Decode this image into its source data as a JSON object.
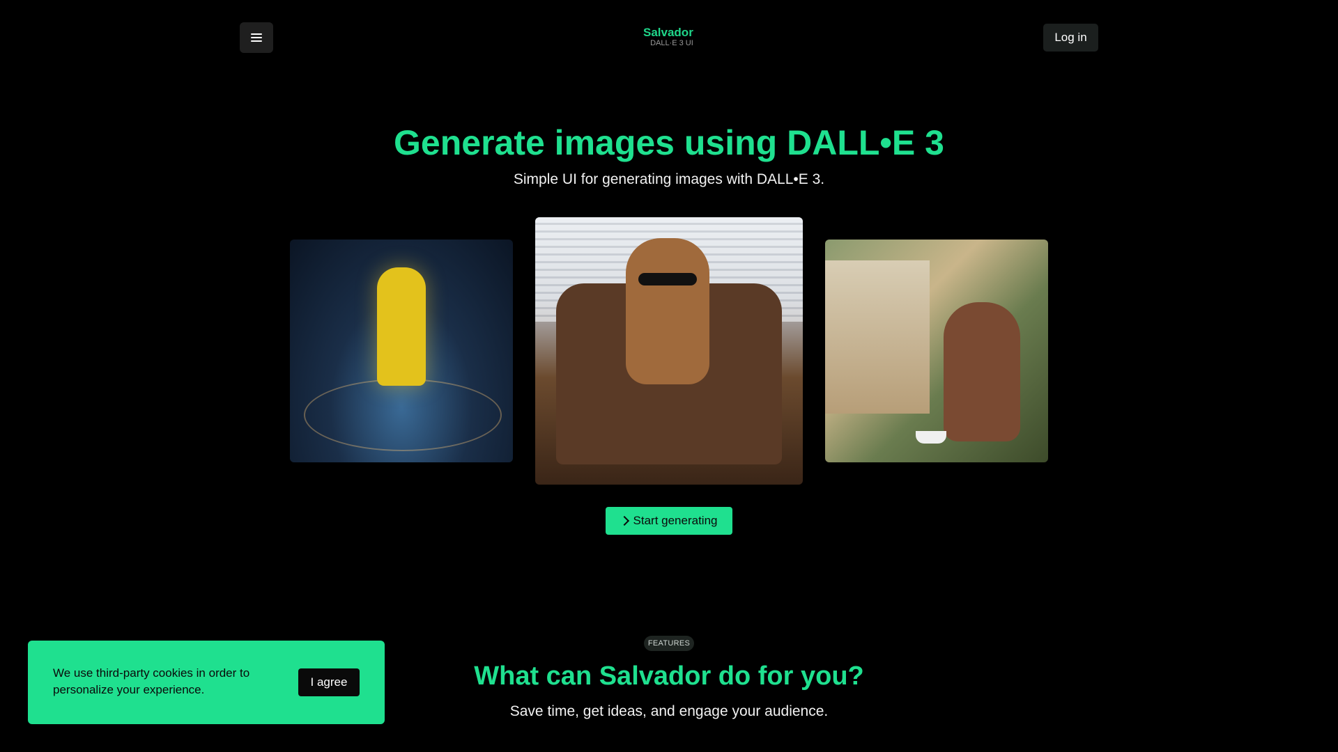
{
  "header": {
    "menu_icon": "hamburger-icon",
    "brand_name": "Salvador",
    "brand_subtitle": "DALL·E 3 UI",
    "login_label": "Log in"
  },
  "hero": {
    "title": "Generate images using DALL•E 3",
    "subtitle": "Simple UI for generating images with DALL•E 3.",
    "cta_label": "Start generating",
    "cta_icon": "chevron-right-icon",
    "images": [
      {
        "name": "girl-in-raincoat-image"
      },
      {
        "name": "cat-in-armchair-image"
      },
      {
        "name": "woman-at-cafe-image"
      }
    ]
  },
  "features": {
    "badge": "FEATURES",
    "title": "What can Salvador do for you?",
    "subtitle": "Save time, get ideas, and engage your audience."
  },
  "cookie_banner": {
    "text": "We use third-party cookies in order to personalize your experience.",
    "agree_label": "I agree"
  },
  "colors": {
    "accent": "#1fe08f",
    "background": "#000000",
    "button_dark": "#1b1f1e"
  }
}
